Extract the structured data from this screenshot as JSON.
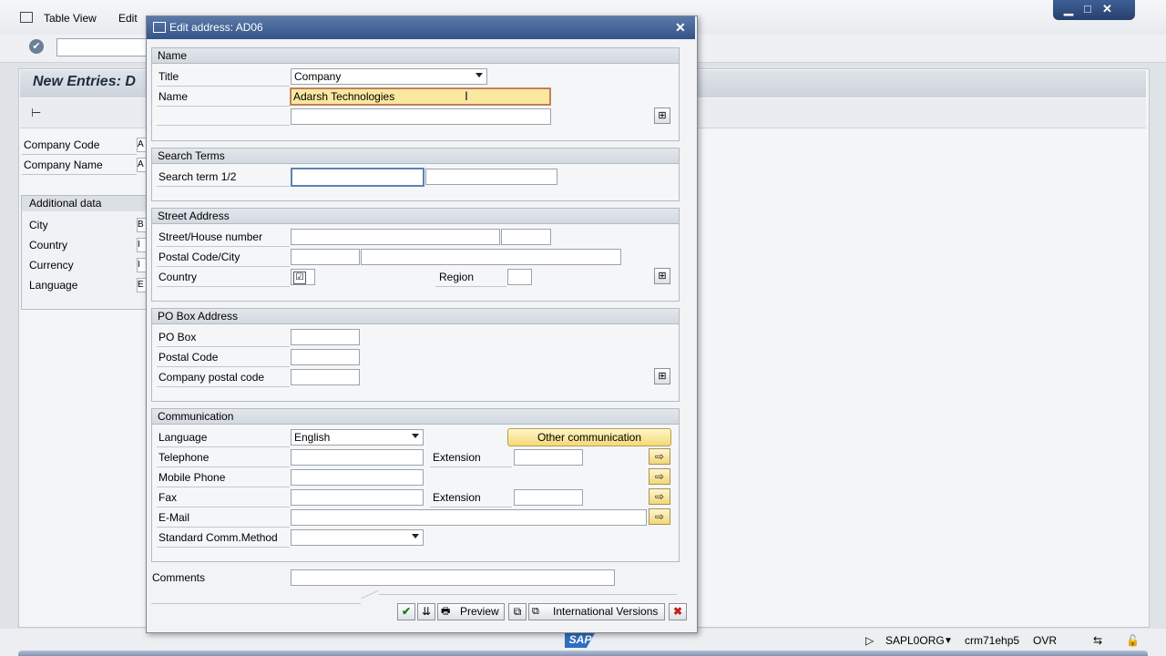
{
  "background": {
    "menu": [
      "Table View",
      "Edit"
    ],
    "screen_title": "New Entries: D",
    "fields": [
      {
        "label": "Company Code",
        "value": "A"
      },
      {
        "label": "Company Name",
        "value": "A"
      }
    ],
    "additional_title": "Additional data",
    "additional_fields": [
      {
        "label": "City",
        "value": "B"
      },
      {
        "label": "Country",
        "value": "I"
      },
      {
        "label": "Currency",
        "value": "I"
      },
      {
        "label": "Language",
        "value": "E"
      }
    ]
  },
  "window_controls": {
    "minimize": "▁",
    "maximize": "□",
    "close": "✕"
  },
  "dialog": {
    "title": "Edit address:  AD06",
    "close": "✕",
    "name": {
      "header": "Name",
      "title_label": "Title",
      "title_value": "Company",
      "name_label": "Name",
      "name_value": "Adarsh Technologies",
      "name2_value": ""
    },
    "search": {
      "header": "Search Terms",
      "label": "Search term 1/2",
      "term1": "",
      "term2": ""
    },
    "street": {
      "header": "Street Address",
      "street_label": "Street/House number",
      "postal_label": "Postal Code/City",
      "country_label": "Country",
      "country_value": "☑",
      "region_label": "Region"
    },
    "pobox": {
      "header": "PO Box Address",
      "pobox_label": "PO Box",
      "postal_label": "Postal Code",
      "company_postal_label": "Company postal code"
    },
    "comm": {
      "header": "Communication",
      "language_label": "Language",
      "language_value": "English",
      "other_button": "Other communication",
      "telephone_label": "Telephone",
      "extension_label": "Extension",
      "mobile_label": "Mobile Phone",
      "fax_label": "Fax",
      "fax_extension_label": "Extension",
      "email_label": "E-Mail",
      "std_method_label": "Standard Comm.Method",
      "std_method_value": ""
    },
    "comments_label": "Comments",
    "comments_value": "",
    "footer": {
      "ok": "✔",
      "copy": "⇊",
      "preview": "Preview",
      "intl": "International Versions",
      "cancel": "✖"
    }
  },
  "status": {
    "program": "SAPL0ORG",
    "server": "crm71ehp5",
    "mode": "OVR",
    "logo": "SAP"
  },
  "colors": {
    "title_bar": "#34538a",
    "active_field": "#fbe8a0",
    "button_yellow": "#f2d777"
  }
}
